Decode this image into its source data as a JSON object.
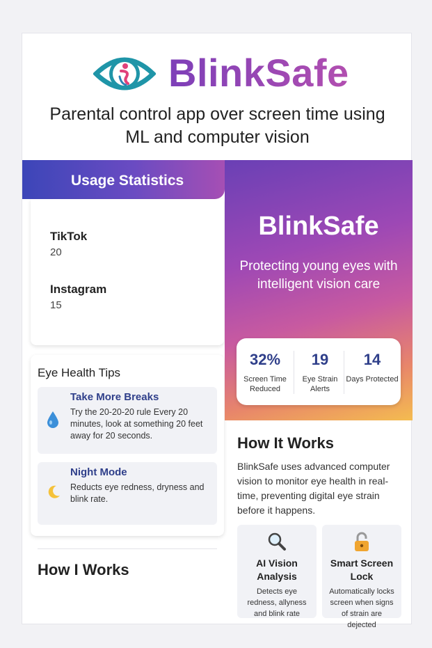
{
  "header": {
    "brand": "BlinkSafe",
    "tagline_line1": "Parental control app over screen time using",
    "tagline_line2": "ML and computer vision"
  },
  "usage": {
    "title": "Usage Statistics",
    "apps": [
      {
        "name": "TikTok",
        "value": "20"
      },
      {
        "name": "Instagram",
        "value": "15"
      }
    ]
  },
  "tips": {
    "title": "Eye Health Tips",
    "items": [
      {
        "icon": "droplet-icon",
        "title": "Take More Breaks",
        "text": "Try the 20-20-20 rule Every 20 minutes, look at something 20 feet away for 20 seconds."
      },
      {
        "icon": "moon-icon",
        "title": "Night Mode",
        "text": "Reducts eye redness, dryness and blink rate."
      }
    ]
  },
  "left_footer": {
    "title": "How I Works"
  },
  "promo": {
    "brand": "BlinkSafe",
    "subtitle": "Protecting young eyes with intelligent vision care",
    "stats": [
      {
        "value": "32%",
        "label": "Screen Time Reduced"
      },
      {
        "value": "19",
        "label": "Eye Strain Alerts"
      },
      {
        "value": "14",
        "label": "Days Protected"
      }
    ]
  },
  "how_it_works": {
    "title": "How It Works",
    "description": "BlinkSafe uses advanced computer vision to monitor eye health in real-time, preventing digital eye strain before it happens.",
    "features": [
      {
        "icon": "magnifier-icon",
        "title": "AI Vision Analysis",
        "text": "Detects eye redness, allyness and blink rate"
      },
      {
        "icon": "lock-icon",
        "title": "Smart Screen Lock",
        "text": "Automatically locks screen when signs of strain are dejected"
      }
    ]
  },
  "colors": {
    "accent_blue": "#2f3f8a",
    "brand_purple": "#8b3fb3",
    "gradient_start": "#6a40b5",
    "gradient_end": "#f4bc50"
  }
}
